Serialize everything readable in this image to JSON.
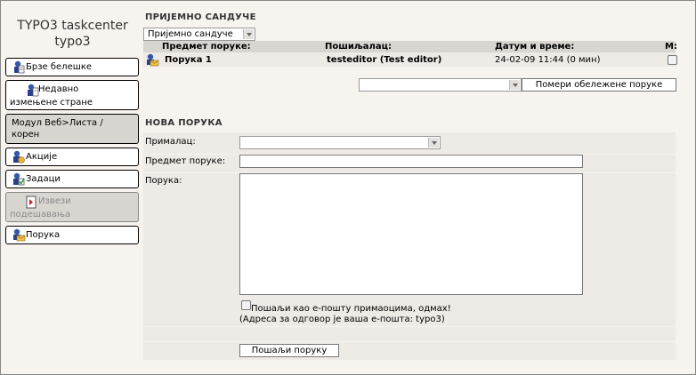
{
  "app": {
    "title_line1": "TYPO3 taskcenter",
    "title_line2": "typo3"
  },
  "sidebar": {
    "items": [
      {
        "label": "Брзе белешке"
      },
      {
        "label_line1": "Недавно",
        "label_line2": "измењене стране"
      },
      {
        "label_line1": "Модул Веб>Листа /",
        "label_line2": "корен"
      },
      {
        "label": "Акције"
      },
      {
        "label": "Задаци"
      },
      {
        "label_line1": "Извези",
        "label_line2": "подешавања"
      },
      {
        "label": "Порука"
      }
    ]
  },
  "inbox": {
    "title": "ПРИЈЕМНО САНДУЧЕ",
    "folder_select": "Пријемно сандуче",
    "columns": {
      "subject": "Предмет поруке:",
      "sender": "Пошиљалац:",
      "date": "Датум и време:",
      "mark": "M:"
    },
    "rows": [
      {
        "subject": "Порука 1",
        "sender": "testeditor (Test editor)",
        "date": "24-02-09 11:44 (0 мин)"
      }
    ],
    "move_select": "",
    "move_button": "Помери обележене поруке"
  },
  "compose": {
    "title": "НОВА ПОРУКА",
    "recipient_label": "Прималац:",
    "recipient_value": "",
    "subject_label": "Предмет поруке:",
    "subject_value": "",
    "message_label": "Порука:",
    "message_value": "",
    "email_checkbox_label": "Пошаљи као е-пошту примаоцима, одмах!",
    "reply_note": "(Адреса за одговор је ваша е-пошта: typo3)",
    "send_button": "Пошаљи поруку"
  },
  "colors": {
    "background": "#F7F3EF",
    "header_band": "#D9D5D1",
    "row_band": "#EEEAE6"
  },
  "icons": [
    "notes-icon",
    "recent-pages-icon",
    "actions-icon",
    "tasks-icon",
    "export-icon",
    "message-icon",
    "envelope-icon"
  ]
}
